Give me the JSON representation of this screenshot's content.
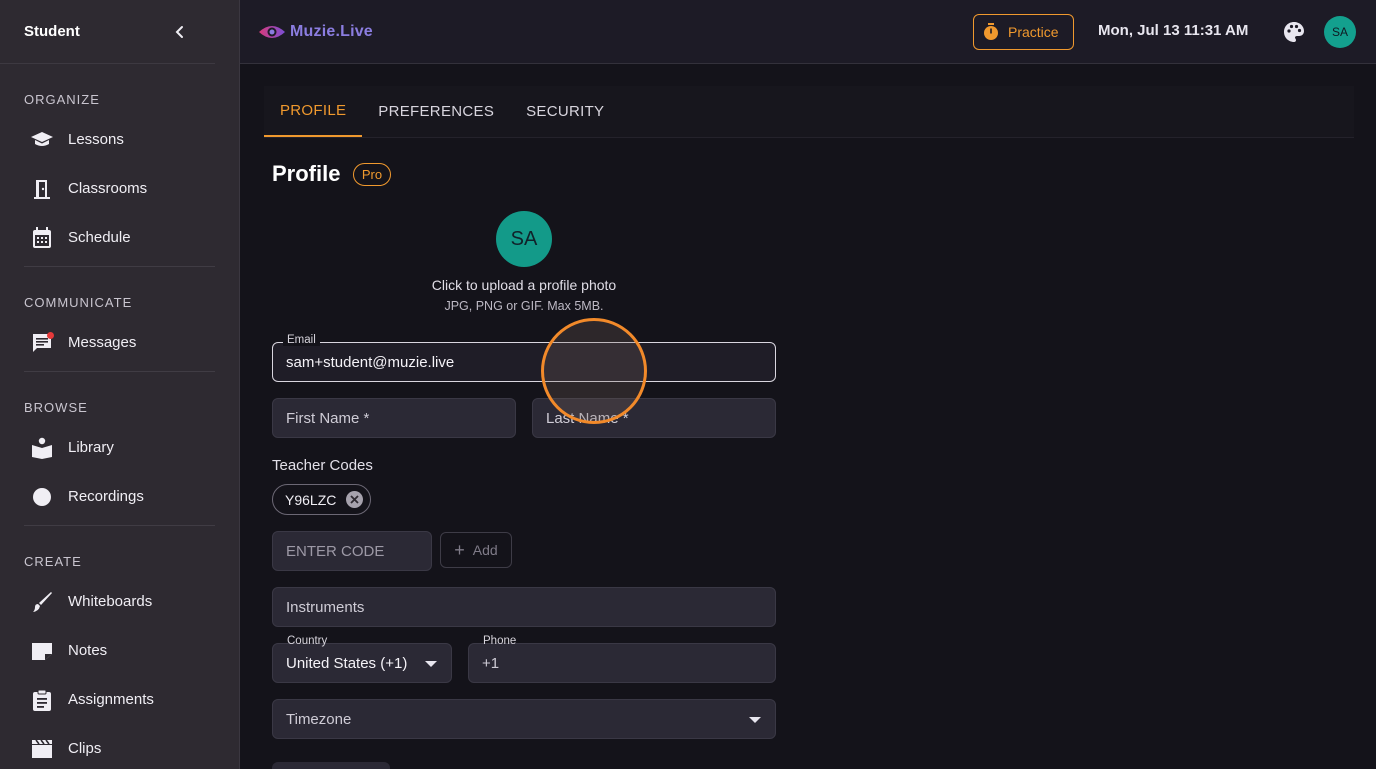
{
  "sidebar": {
    "title": "Student",
    "sections": [
      {
        "title": "ORGANIZE",
        "items": [
          {
            "label": "Lessons",
            "icon": "graduation-cap-icon"
          },
          {
            "label": "Classrooms",
            "icon": "door-icon"
          },
          {
            "label": "Schedule",
            "icon": "calendar-icon"
          }
        ]
      },
      {
        "title": "COMMUNICATE",
        "items": [
          {
            "label": "Messages",
            "icon": "chat-icon"
          }
        ]
      },
      {
        "title": "BROWSE",
        "items": [
          {
            "label": "Library",
            "icon": "book-reader-icon"
          },
          {
            "label": "Recordings",
            "icon": "record-circle-icon"
          }
        ]
      },
      {
        "title": "CREATE",
        "items": [
          {
            "label": "Whiteboards",
            "icon": "brush-icon"
          },
          {
            "label": "Notes",
            "icon": "note-icon"
          },
          {
            "label": "Assignments",
            "icon": "clipboard-icon"
          },
          {
            "label": "Clips",
            "icon": "clapperboard-icon"
          }
        ]
      }
    ]
  },
  "topbar": {
    "logo_text": "Muzie.Live",
    "practice_label": "Practice",
    "datetime": "Mon, Jul 13 11:31 AM",
    "avatar_initials": "SA"
  },
  "tabs": [
    {
      "label": "PROFILE",
      "active": true
    },
    {
      "label": "PREFERENCES",
      "active": false
    },
    {
      "label": "SECURITY",
      "active": false
    }
  ],
  "profile": {
    "title": "Profile",
    "badge": "Pro",
    "avatar_initials": "SA",
    "upload_text": "Click to upload a profile photo",
    "upload_hint": "JPG, PNG or GIF. Max 5MB.",
    "email_label": "Email",
    "email_value": "sam+student@muzie.live",
    "first_name_placeholder": "First Name *",
    "last_name_placeholder": "Last Name *",
    "teacher_codes_label": "Teacher Codes",
    "teacher_codes": [
      "Y96LZC"
    ],
    "code_placeholder": "ENTER CODE",
    "add_label": "Add",
    "instruments_placeholder": "Instruments",
    "country_label": "Country",
    "country_value": "United States (+1)",
    "phone_label": "Phone",
    "phone_value": "+1",
    "timezone_placeholder": "Timezone"
  },
  "colors": {
    "accent": "#f0992e",
    "avatar": "#13a08e",
    "sidebar_bg": "#2e2a31",
    "page_bg": "#14131a"
  }
}
